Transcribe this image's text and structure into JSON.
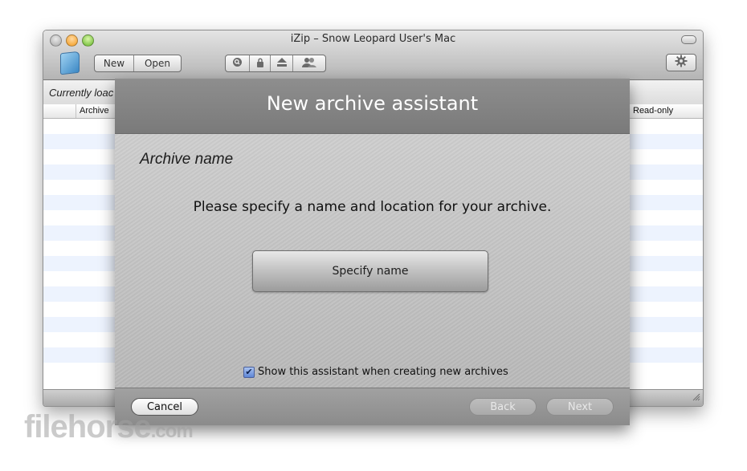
{
  "window": {
    "title": "iZip – Snow Leopard User's Mac"
  },
  "toolbar": {
    "new_label": "New",
    "open_label": "Open",
    "icons": [
      "search-icon",
      "lock-icon",
      "eject-icon",
      "users-icon"
    ],
    "settings_icon": "gear-icon"
  },
  "list": {
    "currently_label": "Currently loac",
    "columns": {
      "archive": "Archive",
      "read_only": "Read-only"
    }
  },
  "sheet": {
    "title": "New archive assistant",
    "section_title": "Archive name",
    "instruction": "Please specify a name and location for your archive.",
    "specify_button": "Specify name",
    "checkbox_label": "Show this assistant when creating new archives",
    "checkbox_checked": true,
    "cancel_label": "Cancel",
    "back_label": "Back",
    "next_label": "Next"
  },
  "watermark": {
    "text": "filehorse",
    "suffix": ".com"
  }
}
